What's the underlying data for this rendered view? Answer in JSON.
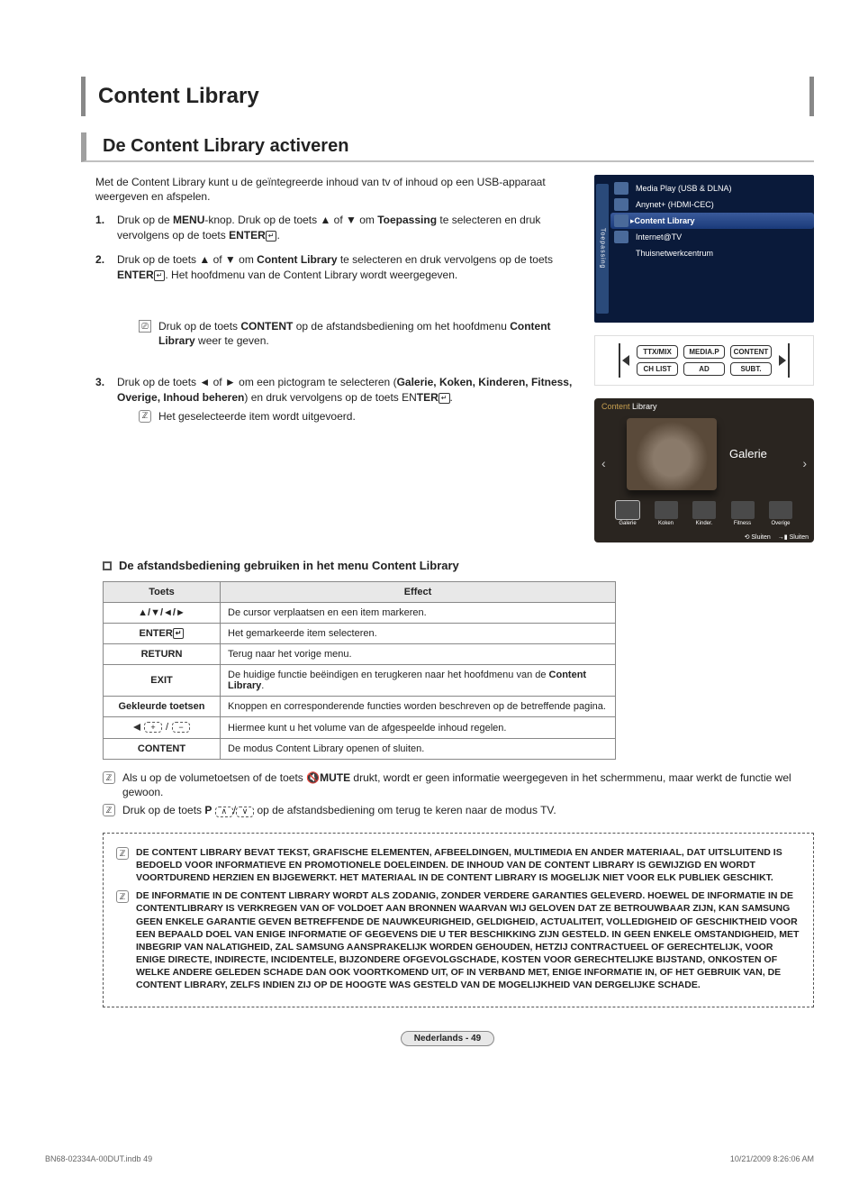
{
  "chapter": "Content Library",
  "section": "De Content Library activeren",
  "intro": "Met de Content Library kunt u de geïntegreerde inhoud van tv of inhoud op een USB-apparaat weergeven en afspelen.",
  "steps": {
    "s1_a": "Druk op de ",
    "s1_menu": "MENU",
    "s1_b": "-knop. Druk op de toets ▲ of ▼ om ",
    "s1_bold1": "Toepassing",
    "s1_c": " te selecteren en druk vervolgens op de toets ",
    "s1_enter": "ENTER",
    "s1_d": ".",
    "s2_a": "Druk op de toets ▲ of ▼ om ",
    "s2_bold": "Content Library",
    "s2_b": " te selecteren en druk vervolgens op de toets ",
    "s2_c": ". Het hoofdmenu van de Content Library wordt weergegeven.",
    "n1_a": "Druk op de toets ",
    "n1_bold": "CONTENT",
    "n1_b": " op de afstandsbediening om het hoofdmenu ",
    "n1_bold2": "Content Library",
    "n1_c": " weer te geven.",
    "s3_a": "Druk op de toets ◄ of ► om een pictogram te selecteren (",
    "s3_items": "Galerie, Koken, Kinderen, Fitness, Overige, Inhoud beheren",
    "s3_b": ") en druk vervolgens op de toets EN",
    "s3_bold": "TER",
    "s3_c": ".",
    "n2": "Het geselecteerde item wordt uitgevoerd."
  },
  "osd": {
    "category": "Toepassing",
    "items": [
      "Media Play (USB & DLNA)",
      "Anynet+ (HDMI-CEC)",
      "Content Library",
      "Internet@TV",
      "Thuisnetwerkcentrum"
    ],
    "selected": 2
  },
  "remote_btns": {
    "r1": "TTX/MIX",
    "r2": "MEDIA.P",
    "r3": "CONTENT",
    "r4": "CH LIST",
    "r5": "AD",
    "r6": "SUBT."
  },
  "gallery": {
    "title": "Content Library",
    "caption": "Galerie",
    "thumbs": [
      "Galerie",
      "Koken",
      "Kinder.",
      "Fitness",
      "Overige"
    ],
    "footer_a": "⟲ Sluiten",
    "footer_b": "→▮ Sluiten"
  },
  "sub_heading": "De afstandsbediening gebruiken in het menu Content Library",
  "table": {
    "h1": "Toets",
    "h2": "Effect",
    "rows": [
      {
        "key": "▲/▼/◄/►",
        "val": "De cursor verplaatsen en een item markeren."
      },
      {
        "key": "ENTER",
        "val": "Het gemarkeerde item selecteren.",
        "enter_glyph": true
      },
      {
        "key": "RETURN",
        "val": "Terug naar het vorige menu."
      },
      {
        "key": "EXIT",
        "val": "De huidige functie beëindigen en terugkeren naar het hoofdmenu van de Content Library.",
        "bold_tail": "Content Library"
      },
      {
        "key": "Gekleurde toetsen",
        "val": "Knoppen en corresponderende functies worden beschreven op de betreffende pagina."
      },
      {
        "key": "_VOL_",
        "val": "Hiermee kunt u het volume van de afgespeelde inhoud regelen."
      },
      {
        "key": "CONTENT",
        "val": "De modus Content Library openen of sluiten."
      }
    ]
  },
  "notes_after": {
    "a1": "Als u op de volumetoetsen of de toets ",
    "mute_ico": "🔇",
    "a_bold": "MUTE",
    "a2": " drukt, wordt er geen informatie weergegeven in het schermmenu, maar werkt de functie wel gewoon.",
    "b1": "Druk op de toets ",
    "b_bold": "P",
    "b2": " op de afstandsbediening om terug te keren naar de modus TV."
  },
  "box": {
    "p1": "DE CONTENT LIBRARY BEVAT TEKST, GRAFISCHE ELEMENTEN, AFBEELDINGEN, MULTIMEDIA EN ANDER MATERIAAL, DAT UITSLUITEND IS BEDOELD VOOR INFORMATIEVE EN PROMOTIONELE DOELEINDEN. DE INHOUD VAN DE CONTENT LIBRARY IS GEWIJZIGD EN WORDT VOORTDUREND HERZIEN EN BIJGEWERKT. HET MATERIAAL IN DE CONTENT LIBRARY IS MOGELIJK NIET VOOR ELK PUBLIEK GESCHIKT.",
    "p2": "DE INFORMATIE IN DE CONTENT LIBRARY WORDT ALS ZODANIG, ZONDER VERDERE GARANTIES GELEVERD. HOEWEL DE INFORMATIE IN DE CONTENTLIBRARY IS VERKREGEN VAN OF VOLDOET AAN BRONNEN WAARVAN WIJ GELOVEN DAT ZE BETROUWBAAR ZIJN, KAN SAMSUNG GEEN ENKELE GARANTIE GEVEN BETREFFENDE DE NAUWKEURIGHEID, GELDIGHEID, ACTUALITEIT, VOLLEDIGHEID OF GESCHIKTHEID VOOR EEN BEPAALD DOEL VAN ENIGE INFORMATIE OF GEGEVENS DIE U TER BESCHIKKING ZIJN GESTELD. IN GEEN ENKELE OMSTANDIGHEID, MET INBEGRIP VAN NALATIGHEID, ZAL SAMSUNG AANSPRAKELIJK WORDEN GEHOUDEN, HETZIJ CONTRACTUEEL OF GERECHTELIJK, VOOR ENIGE DIRECTE, INDIRECTE, INCIDENTELE, BIJZONDERE OFGEVOLGSCHADE, KOSTEN VOOR GERECHTELIJKE BIJSTAND, ONKOSTEN OF WELKE ANDERE GELEDEN SCHADE DAN OOK VOORTKOMEND UIT, OF IN VERBAND MET, ENIGE INFORMATIE IN, OF HET GEBRUIK VAN, DE CONTENT LIBRARY, ZELFS INDIEN ZIJ OP DE HOOGTE WAS GESTELD VAN DE MOGELIJKHEID VAN DERGELIJKE SCHADE."
  },
  "page_marker": "Nederlands - 49",
  "print_left": "BN68-02334A-00DUT.indb   49",
  "print_right": "10/21/2009   8:26:06 AM"
}
